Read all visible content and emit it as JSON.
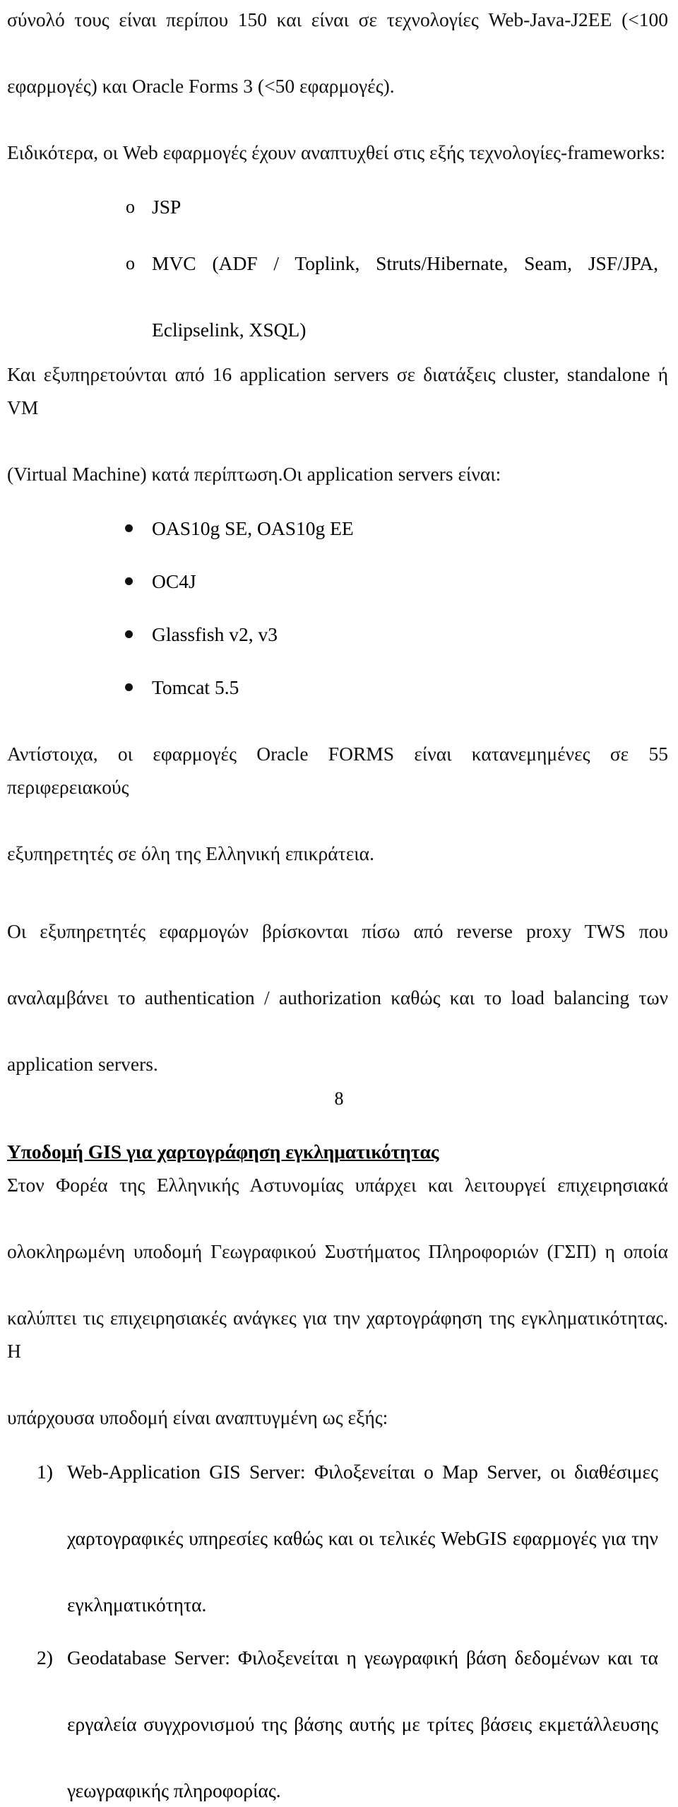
{
  "document": {
    "page_number": "8",
    "language": "el"
  },
  "content": {
    "intro_paragraph": {
      "line1": "σύνολό τους είναι περίπου 150 και είναι σε τεχνολογίες Web-Java-J2EE (<100",
      "line2": "εφαρμογές) και Oracle Forms 3 (<50 εφαρμογές)."
    },
    "frameworks_intro": "Ειδικότερα, οι Web εφαρμογές έχουν αναπτυχθεί στις εξής τεχνολογίες-frameworks:",
    "frameworks_list": [
      {
        "marker": "o",
        "text": "JSP"
      },
      {
        "marker": "o",
        "line1": "MVC (ADF / Toplink, Struts/Hibernate, Seam, JSF/JPA,",
        "line2": "Eclipselink, XSQL)"
      }
    ],
    "app_servers_intro": {
      "line1": "Και εξυπηρετούνται από 16 application servers σε διατάξεις cluster, standalone ή VM",
      "line2": "(Virtual Machine) κατά περίπτωση.Οι application servers είναι:"
    },
    "app_servers_list": [
      "OAS10g SE, OAS10g EE",
      "OC4J",
      "Glassfish v2, v3",
      "Tomcat 5.5"
    ],
    "forms_paragraph": {
      "line1": "Αντίστοιχα, οι εφαρμογές Oracle FORMS είναι κατανεμημένες σε 55 περιφερειακούς",
      "line2": "εξυπηρετητές σε όλη της Ελληνική επικράτεια."
    },
    "proxy_paragraph": {
      "line1": "Οι εξυπηρετητές εφαρμογών βρίσκονται πίσω από reverse proxy TWS που",
      "line2": "αναλαμβάνει το authentication / authorization καθώς και το load balancing των",
      "line3": "application servers."
    },
    "gis_heading": "Υποδομή GIS για χαρτογράφηση εγκληματικότητας",
    "gis_paragraph": {
      "line1": "Στον Φορέα της Ελληνικής Αστυνομίας υπάρχει και λειτουργεί επιχειρησιακά",
      "line2": "ολοκληρωμένη υποδομή Γεωγραφικού Συστήματος Πληροφοριών (ΓΣΠ) η οποία",
      "line3": "καλύπτει τις επιχειρησιακές ανάγκες για την χαρτογράφηση της εγκληματικότητας. Η",
      "line4": "υπάρχουσα υποδομή είναι αναπτυγμένη ως εξής:"
    },
    "gis_list": [
      {
        "marker": "1)",
        "line1": "Web-Application GIS Server: Φιλοξενείται ο Map Server, οι διαθέσιμες",
        "line2": "χαρτογραφικές υπηρεσίες καθώς και οι τελικές WebGIS εφαρμογές για την",
        "line3": "εγκληματικότητα."
      },
      {
        "marker": "2)",
        "line1": "Geodatabase Server: Φιλοξενείται η γεωγραφική βάση δεδομένων και τα",
        "line2": "εργαλεία συγχρονισμού της βάσης αυτής με τρίτες βάσεις εκμετάλλευσης",
        "line3": "γεωγραφικής πληροφορίας."
      }
    ]
  }
}
